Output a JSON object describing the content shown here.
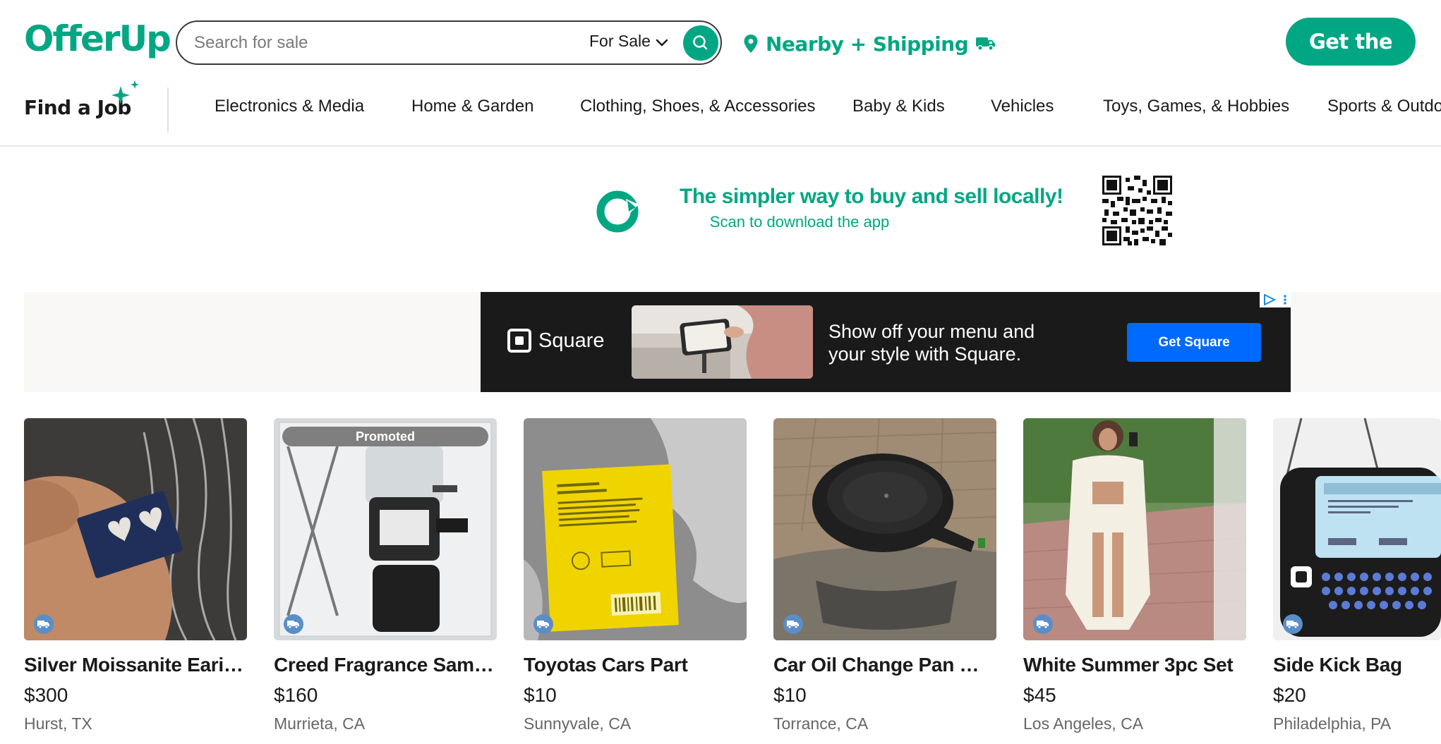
{
  "header": {
    "logo": "OfferUp",
    "search_placeholder": "Search for sale",
    "search_mode": "For Sale",
    "location_label": "Nearby + Shipping",
    "get_app_label": "Get the app"
  },
  "nav": {
    "find_job": "Find a Job",
    "categories": [
      "Electronics & Media",
      "Home & Garden",
      "Clothing, Shoes, & Accessories",
      "Baby & Kids",
      "Vehicles",
      "Toys, Games, & Hobbies",
      "Sports & Outdoors"
    ]
  },
  "promo": {
    "title": "The simpler way to buy and sell locally!",
    "subtitle": "Scan to download the app"
  },
  "ad": {
    "brand": "Square",
    "copy_line1": "Show off your menu and",
    "copy_line2": "your style with Square.",
    "cta": "Get Square"
  },
  "listings": [
    {
      "title": "Silver Moissanite Earin...",
      "price": "$300",
      "location": "Hurst, TX",
      "promoted": false
    },
    {
      "title": "Creed Fragrance Sampl...",
      "price": "$160",
      "location": "Murrieta, CA",
      "promoted": true,
      "promoted_label": "Promoted"
    },
    {
      "title": "Toyotas Cars Part",
      "price": "$10",
      "location": "Sunnyvale, CA",
      "promoted": false
    },
    {
      "title": "Car Oil Change Pan Wi...",
      "price": "$10",
      "location": "Torrance, CA",
      "promoted": false
    },
    {
      "title": "White Summer 3pc Set",
      "price": "$45",
      "location": "Los Angeles, CA",
      "promoted": false
    },
    {
      "title": "Side Kick Bag",
      "price": "$20",
      "location": "Philadelphia, PA",
      "promoted": false
    }
  ],
  "colors": {
    "brand_green": "#01a782",
    "ad_background": "#1a1a1a",
    "ad_cta": "#006aff",
    "shipping_badge": "#5b8ec7"
  },
  "icons": [
    "search-icon",
    "chevron-down-icon",
    "location-pin-icon",
    "truck-icon",
    "sparkle-icon",
    "offerup-refresh-icon",
    "qr-code-icon",
    "square-logo-icon",
    "ad-choices-icon"
  ]
}
